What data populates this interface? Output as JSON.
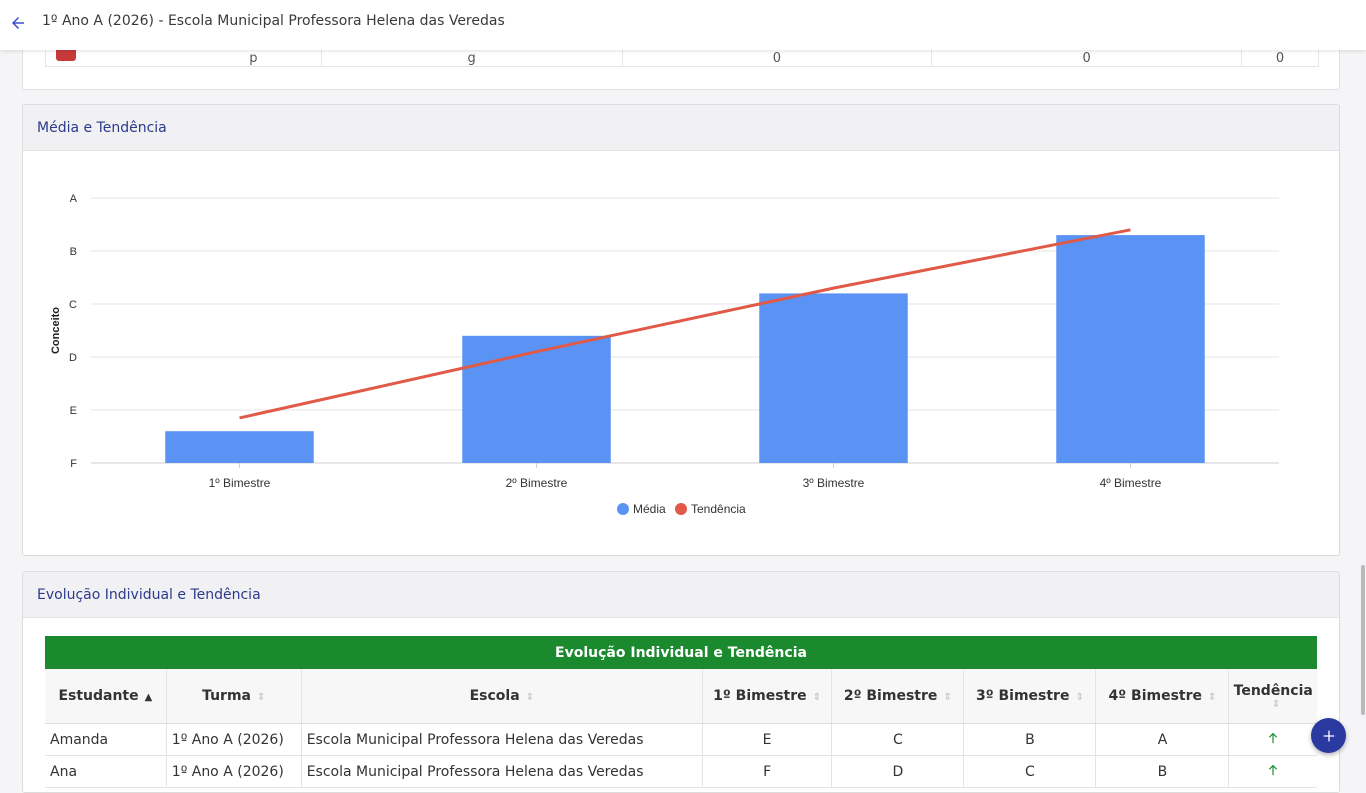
{
  "header": {
    "title": "1º Ano A (2026) - Escola Municipal Professora Helena das Veredas"
  },
  "prev_table": {
    "cells": [
      "p",
      "g",
      "0",
      "0",
      "0"
    ]
  },
  "media_card": {
    "title": "Média e Tendência"
  },
  "chart_data": {
    "type": "bar",
    "categories": [
      "1º Bimestre",
      "2º Bimestre",
      "3º Bimestre",
      "4º Bimestre"
    ],
    "y_ticks": [
      "F",
      "E",
      "D",
      "C",
      "B",
      "A"
    ],
    "ylabel": "Conceito",
    "series": [
      {
        "name": "Média",
        "type": "bar",
        "color": "#5b93f5",
        "values": [
          0.6,
          2.4,
          3.2,
          4.3
        ]
      },
      {
        "name": "Tendência",
        "type": "line",
        "color": "#e05a47",
        "values": [
          0.85,
          2.1,
          3.3,
          4.4
        ]
      }
    ],
    "ylim": [
      0,
      5
    ],
    "grid": true,
    "legend": "bottom-center"
  },
  "evo_card": {
    "title": "Evolução Individual e Tendência",
    "table_title": "Evolução Individual e Tendência",
    "columns": [
      "Estudante",
      "Turma",
      "Escola",
      "1º Bimestre",
      "2º Bimestre",
      "3º Bimestre",
      "4º Bimestre",
      "Tendência"
    ],
    "rows": [
      [
        "Amanda",
        "1º Ano A (2026)",
        "Escola Municipal Professora Helena das Veredas",
        "E",
        "C",
        "B",
        "A"
      ],
      [
        "Ana",
        "1º Ano A (2026)",
        "Escola Municipal Professora Helena das Veredas",
        "F",
        "D",
        "C",
        "B"
      ]
    ],
    "trend_color": "#1b8a2e"
  }
}
